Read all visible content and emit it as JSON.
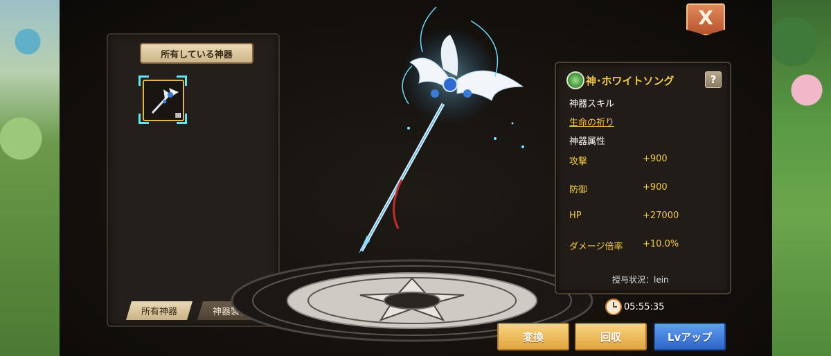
{
  "left_panel": {
    "header": "所有している神器",
    "items": [
      {
        "icon": "staff-icon",
        "level": "Ⅲ"
      }
    ],
    "tabs": {
      "owned": "所有神器",
      "craft": "神器製作"
    }
  },
  "info": {
    "name": "神･ホワイトソング",
    "help": "?",
    "skill_heading": "神器スキル",
    "skill_name": "生命の祈り",
    "attr_heading": "神器属性",
    "stats": [
      {
        "label": "攻撃",
        "value": "+900"
      },
      {
        "label": "防御",
        "value": "+900"
      },
      {
        "label": "HP",
        "value": "+27000"
      },
      {
        "label": "ダメージ倍率",
        "value": "+10.0%"
      }
    ],
    "grant": "授与状況：lein"
  },
  "timer": "05:55:35",
  "buttons": {
    "convert": "変換",
    "recover": "回収",
    "levelup": "Lvアップ"
  },
  "close": "X",
  "colors": {
    "accent_gold": "#f2c94c",
    "button_gold": "#e2a540",
    "button_blue": "#2f64c8",
    "frame_cyan": "#5fe6f0"
  }
}
